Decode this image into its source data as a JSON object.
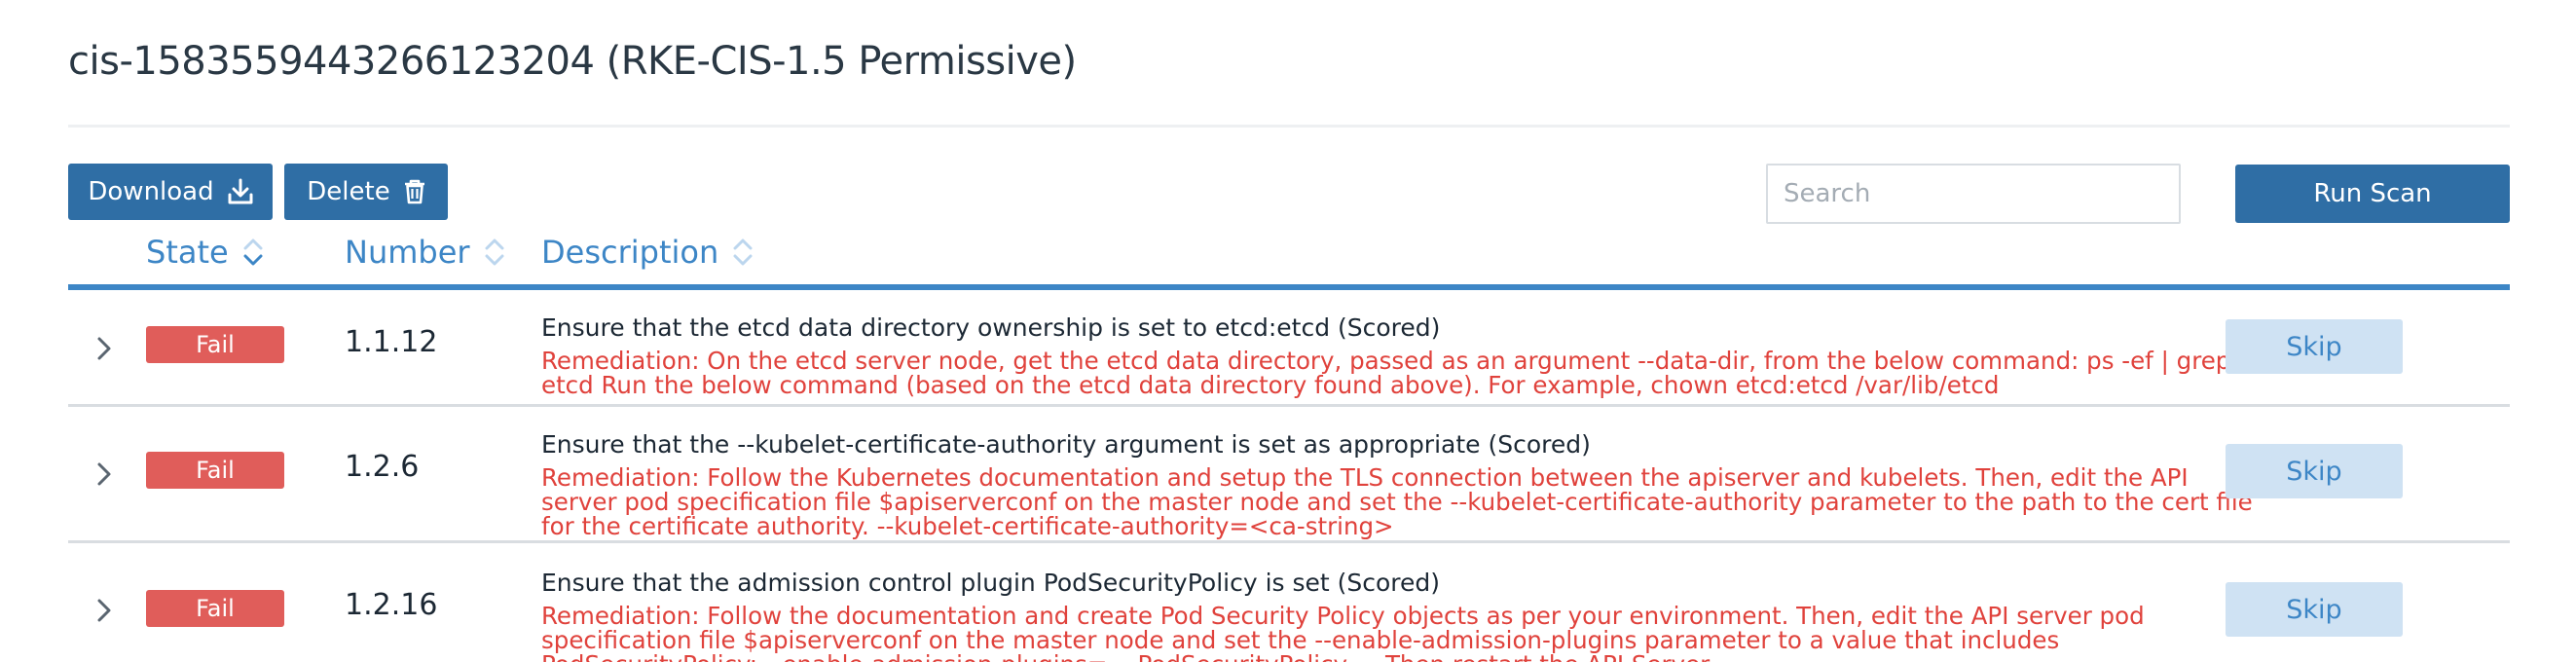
{
  "page": {
    "title": "cis-1583559443266123204 (RKE-CIS-1.5 Permissive)"
  },
  "toolbar": {
    "download_label": "Download",
    "delete_label": "Delete",
    "search_placeholder": "Search",
    "run_scan_label": "Run Scan"
  },
  "table": {
    "columns": [
      "State",
      "Number",
      "Description"
    ],
    "rows": [
      {
        "state": "Fail",
        "number": "1.1.12",
        "description": "Ensure that the etcd data directory ownership is set to etcd:etcd (Scored)",
        "remediation": "Remediation: On the etcd server node, get the etcd data directory, passed as an argument --data-dir, from the below command: ps -ef | grep etcd Run the below command (based on the etcd data directory found above). For example, chown etcd:etcd /var/lib/etcd",
        "action": "Skip"
      },
      {
        "state": "Fail",
        "number": "1.2.6",
        "description": "Ensure that the --kubelet-certificate-authority argument is set as appropriate (Scored)",
        "remediation": "Remediation: Follow the Kubernetes documentation and setup the TLS connection between the apiserver and kubelets. Then, edit the API server pod specification file $apiserverconf on the master node and set the --kubelet-certificate-authority parameter to the path to the cert file for the certificate authority. --kubelet-certificate-authority=<ca-string>",
        "action": "Skip"
      },
      {
        "state": "Fail",
        "number": "1.2.16",
        "description": "Ensure that the admission control plugin PodSecurityPolicy is set (Scored)",
        "remediation": "Remediation: Follow the documentation and create Pod Security Policy objects as per your environment. Then, edit the API server pod specification file $apiserverconf on the master node and set the --enable-admission-plugins parameter to a value that includes PodSecurityPolicy: --enable-admission-plugins=...,PodSecurityPolicy,... Then restart the API Server.",
        "action": "Skip"
      }
    ]
  },
  "colors": {
    "primary": "#2f6ea5",
    "link": "#3d86c6",
    "fail": "#e05d5a",
    "remediation": "#e0423c",
    "skip_bg": "#cfe2f3"
  },
  "icons": {
    "download": "download-icon",
    "delete": "trash-icon",
    "sort": "sort-icon",
    "expand": "chevron-right-icon"
  }
}
